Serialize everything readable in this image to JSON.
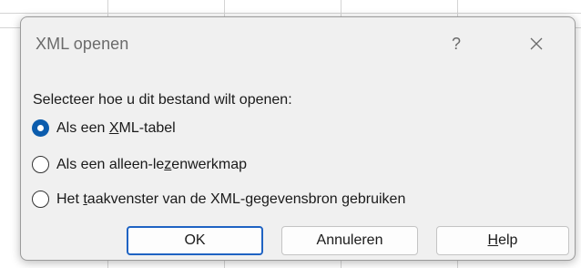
{
  "dialog": {
    "title": "XML openen",
    "help_glyph": "?",
    "close_icon": "close-icon",
    "prompt": "Selecteer hoe u dit bestand wilt openen:",
    "options": [
      {
        "pre": "Als een ",
        "key": "X",
        "post": "ML-tabel",
        "selected": true
      },
      {
        "pre": "Als een alleen-le",
        "key": "z",
        "post": "enwerkmap",
        "selected": false
      },
      {
        "pre": "Het ",
        "key": "t",
        "post": "aakvenster van de XML-gegevensbron gebruiken",
        "selected": false
      }
    ],
    "buttons": {
      "ok": "OK",
      "cancel": "Annuleren",
      "help_key": "H",
      "help_rest": "elp"
    }
  },
  "colors": {
    "accent": "#0b5cad",
    "default_button_border": "#1f63c3",
    "dialog_background": "#f0f0f0"
  }
}
